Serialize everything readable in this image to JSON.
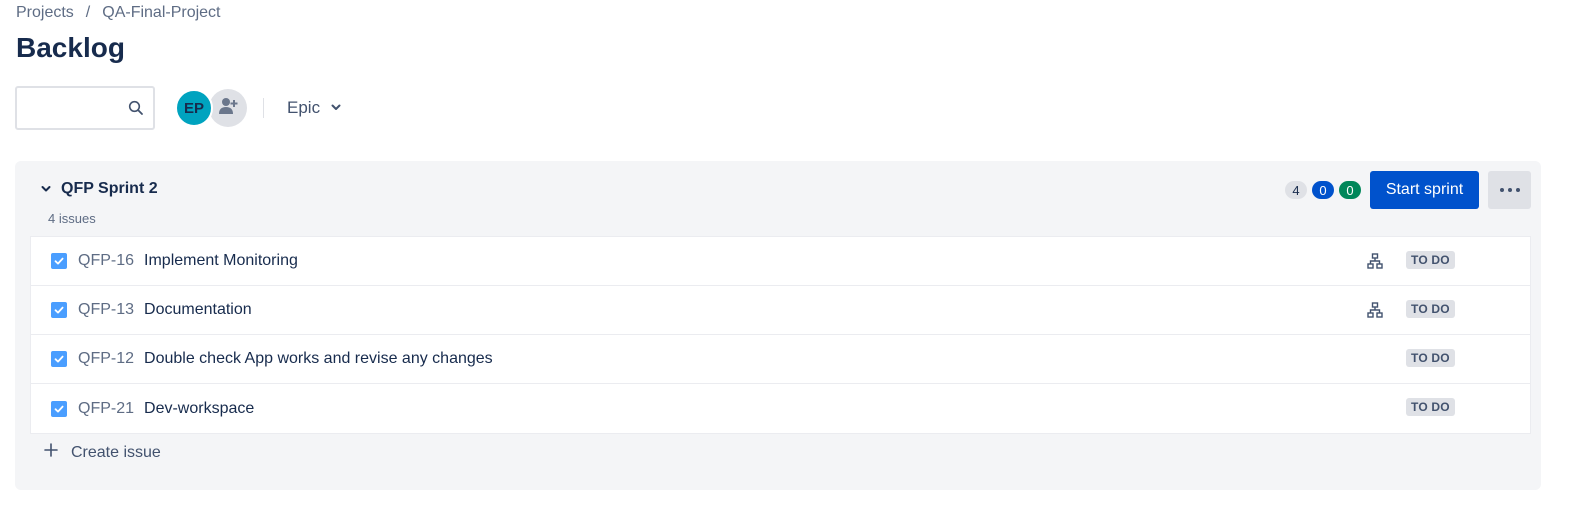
{
  "breadcrumb": {
    "root": "Projects",
    "separator": "/",
    "project": "QA-Final-Project"
  },
  "page": {
    "title": "Backlog"
  },
  "toolbar": {
    "search": {
      "value": "",
      "placeholder": ""
    },
    "avatar_initials": "EP",
    "epic_filter": "Epic"
  },
  "sprint": {
    "name": "QFP Sprint 2",
    "issue_count": "4 issues",
    "counts": {
      "todo": "4",
      "in_progress": "0",
      "done": "0"
    },
    "start_label": "Start sprint",
    "issues": [
      {
        "key": "QFP-16",
        "summary": "Implement Monitoring",
        "status": "TO DO",
        "has_child": true
      },
      {
        "key": "QFP-13",
        "summary": "Documentation",
        "status": "TO DO",
        "has_child": true
      },
      {
        "key": "QFP-12",
        "summary": "Double check App works and revise any changes",
        "status": "TO DO",
        "has_child": false
      },
      {
        "key": "QFP-21",
        "summary": "Dev-workspace",
        "status": "TO DO",
        "has_child": false
      }
    ],
    "create_label": "Create issue"
  },
  "colors": {
    "primary": "#0052cc",
    "done": "#00875a",
    "avatar": "#00a3bf",
    "checkbox": "#4a9eff"
  }
}
